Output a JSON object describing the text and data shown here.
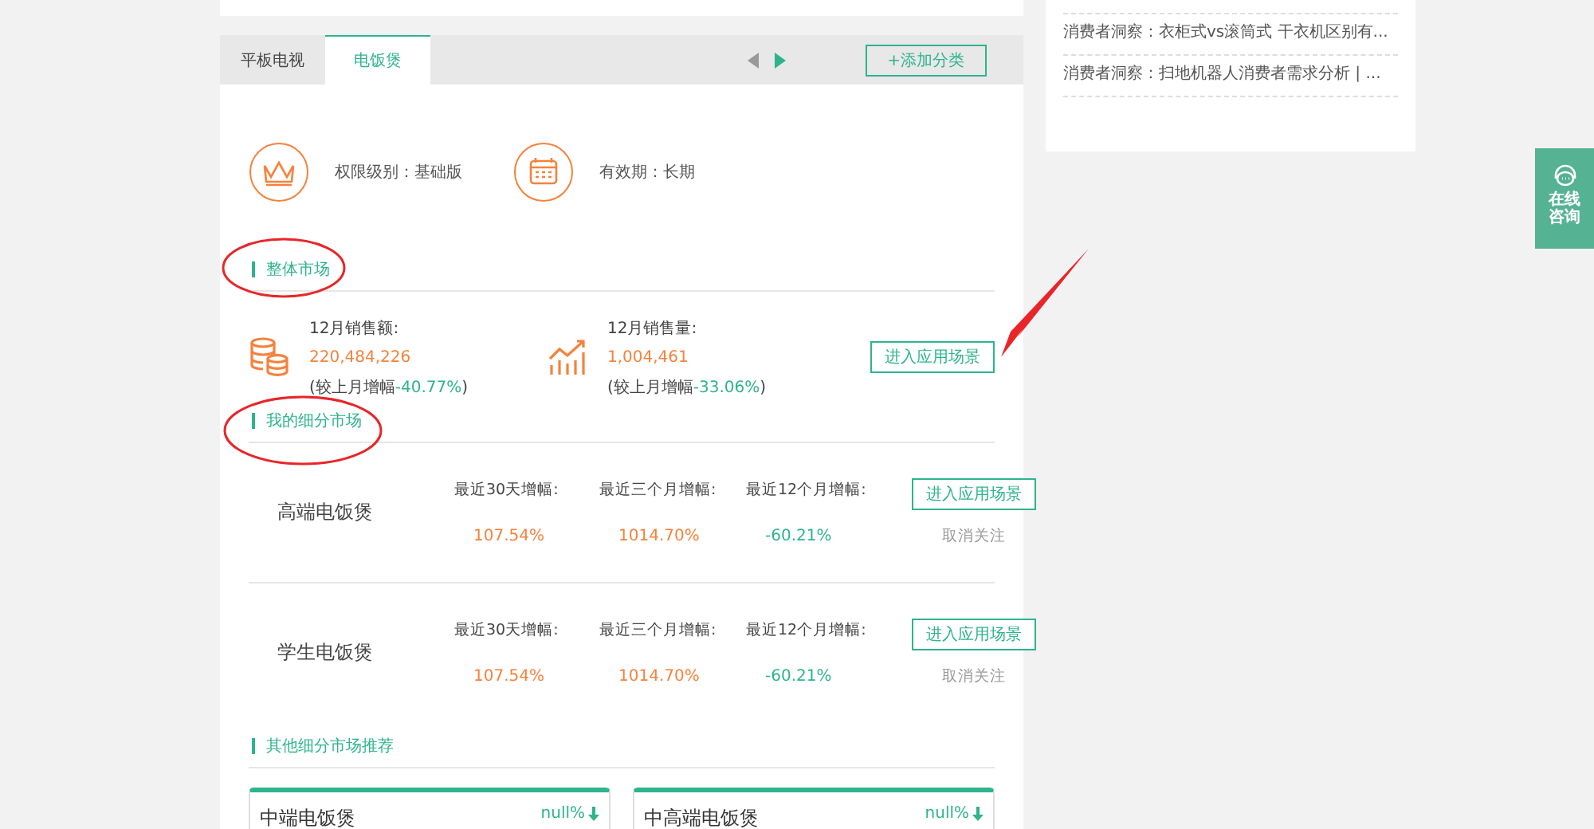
{
  "tabs": [
    {
      "label": "平板电视",
      "selected": false
    },
    {
      "label": "电饭煲",
      "selected": true
    }
  ],
  "tab_nav": [
    {
      "kind": "prev",
      "disabled": true
    },
    {
      "kind": "next",
      "disabled": false
    }
  ],
  "add_category_button": "+添加分类",
  "info": [
    {
      "kind": "crown",
      "text": "权限级别：基础版"
    },
    {
      "kind": "calendar",
      "text": "有效期：长期"
    }
  ],
  "overall_market": {
    "title": "整体市场",
    "button": "进入应用场景",
    "stats": [
      {
        "kind": "coins",
        "label": "12月销售额:",
        "value": "220,484,226",
        "change_prefix": "(较上月增幅",
        "change": "-40.77%",
        "change_suffix": ")",
        "color": "#2db48c"
      },
      {
        "kind": "growth",
        "label": "12月销售量:",
        "value": "1,004,461",
        "change_prefix": "(较上月增幅",
        "change": "-33.06%",
        "change_suffix": ")",
        "color": "#2db48c"
      }
    ]
  },
  "my_segments": {
    "title": "我的细分市场",
    "rows": [
      {
        "name": "高端电饭煲",
        "button": "进入应用场景",
        "unfollow": "取消关注",
        "metrics": [
          {
            "label": "最近30天增幅:",
            "value": "107.54%",
            "color": "#f5823c"
          },
          {
            "label": "最近三个月增幅:",
            "value": "1014.70%",
            "color": "#f5823c"
          },
          {
            "label": "最近12个月增幅:",
            "value": "-60.21%",
            "color": "#2db48c"
          }
        ]
      },
      {
        "name": "学生电饭煲",
        "button": "进入应用场景",
        "unfollow": "取消关注",
        "metrics": [
          {
            "label": "最近30天增幅:",
            "value": "107.54%",
            "color": "#f5823c"
          },
          {
            "label": "最近三个月增幅:",
            "value": "1014.70%",
            "color": "#f5823c"
          },
          {
            "label": "最近12个月增幅:",
            "value": "-60.21%",
            "color": "#2db48c"
          }
        ]
      }
    ]
  },
  "other_segments": {
    "title": "其他细分市场推荐",
    "cards": [
      {
        "name": "中端电饭煲",
        "change": "null%",
        "kind": "down"
      },
      {
        "name": "中高端电饭煲",
        "change": "null%",
        "kind": "down"
      }
    ]
  },
  "news": [
    "消费者洞察：衣柜式vs滚筒式 干衣机区别有...",
    "消费者洞察：扫地机器人消费者需求分析 | ..."
  ],
  "consult_button": "在线咨询"
}
